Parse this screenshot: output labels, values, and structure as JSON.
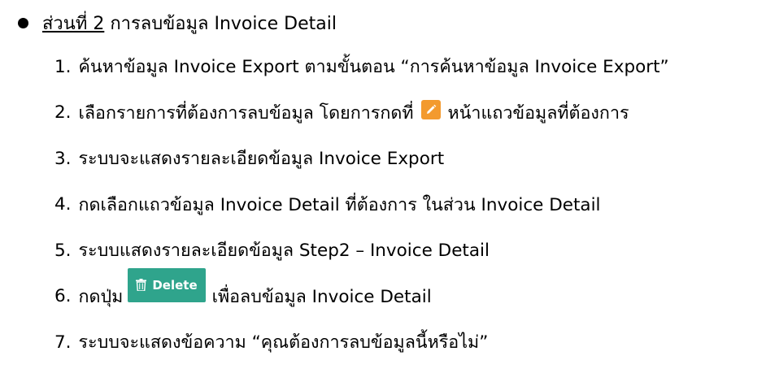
{
  "section": {
    "label": "ส่วนที่ 2",
    "title": "การลบข้อมูล Invoice Detail"
  },
  "steps": [
    {
      "num": "1.",
      "text": "ค้นหาข้อมูล Invoice Export ตามขั้นตอน “การค้นหาข้อมูล Invoice Export”"
    },
    {
      "num": "2.",
      "text_before": "เลือกรายการที่ต้องการลบข้อมูล โดยการกดที่",
      "icon": "pencil-edit-icon",
      "text_after": "หน้าแถวข้อมูลที่ต้องการ"
    },
    {
      "num": "3.",
      "text": "ระบบจะแสดงรายละเอียดข้อมูล Invoice Export"
    },
    {
      "num": "4.",
      "text": "กดเลือกแถวข้อมูล Invoice Detail ที่ต้องการ ในส่วน Invoice Detail"
    },
    {
      "num": "5.",
      "text": "ระบบแสดงรายละเอียดข้อมูล Step2 – Invoice Detail"
    },
    {
      "num": "6.",
      "text_before": "กดปุ่ม",
      "button_label": "Delete",
      "button_icon": "trash-icon",
      "text_after": "เพื่อลบข้อมูล Invoice Detail"
    },
    {
      "num": "7.",
      "text": "ระบบจะแสดงข้อความ “คุณต้องการลบข้อมูลนี้หรือไม่”"
    }
  ],
  "colors": {
    "edit_icon_bg": "#f39a2e",
    "delete_button_bg": "#2fa48c"
  }
}
